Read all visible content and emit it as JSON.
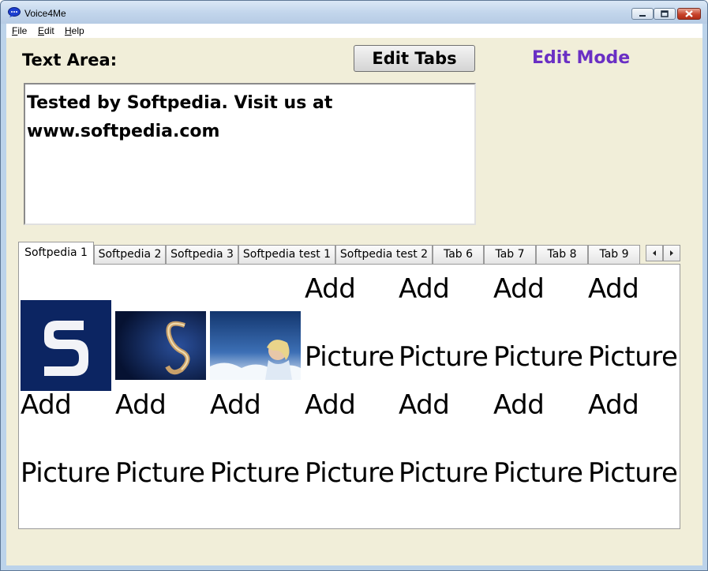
{
  "window": {
    "title": "Voice4Me",
    "controls": [
      "minimize",
      "maximize",
      "close"
    ]
  },
  "menu": {
    "items": [
      "File",
      "Edit",
      "Help"
    ]
  },
  "header": {
    "text_area_label": "Text Area:",
    "edit_tabs_button": "Edit Tabs",
    "mode_label": "Edit Mode",
    "mode_color": "#6a2fc4"
  },
  "text_area": {
    "line1": "Tested by Softpedia. Visit us at",
    "line2": "www.softpedia.com"
  },
  "tabs": [
    {
      "label": "Softpedia 1",
      "active": true
    },
    {
      "label": "Softpedia 2"
    },
    {
      "label": "Softpedia 3"
    },
    {
      "label": "Softpedia test 1"
    },
    {
      "label": "Softpedia test 2"
    },
    {
      "label": "Tab 6"
    },
    {
      "label": "Tab 7"
    },
    {
      "label": "Tab 8"
    },
    {
      "label": "Tab 9"
    }
  ],
  "tab_scroll": [
    "scroll-left-icon",
    "scroll-right-icon"
  ],
  "grid": {
    "add_word": "Add",
    "picture_word": "Picture",
    "cells": [
      {
        "type": "image",
        "icon": "softpedia-s-logo"
      },
      {
        "type": "image",
        "icon": "softpedia-swirl-wallpaper"
      },
      {
        "type": "image",
        "icon": "softpedia-portrait-wallpaper"
      },
      {
        "type": "add"
      },
      {
        "type": "add"
      },
      {
        "type": "add"
      },
      {
        "type": "add"
      },
      {
        "type": "add"
      },
      {
        "type": "add"
      },
      {
        "type": "add"
      },
      {
        "type": "add"
      },
      {
        "type": "add"
      },
      {
        "type": "add"
      },
      {
        "type": "add"
      }
    ]
  }
}
